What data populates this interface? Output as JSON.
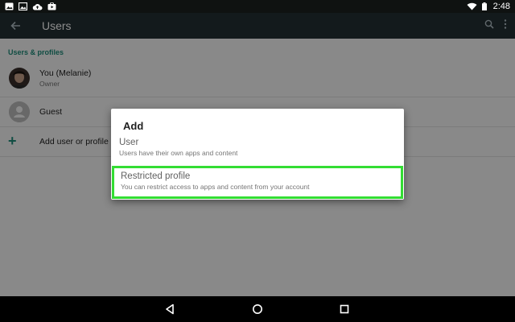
{
  "status_bar": {
    "time": "2:48",
    "left_icons": [
      "image-icon",
      "image-icon",
      "cloud-upload-icon",
      "play-store-icon"
    ],
    "right_icons": [
      "wifi-icon",
      "battery-icon"
    ]
  },
  "toolbar": {
    "title": "Users",
    "back_icon": "arrow-back-icon",
    "actions": [
      "search-icon",
      "more-vert-icon"
    ]
  },
  "section": {
    "header": "Users & profiles"
  },
  "users": [
    {
      "name": "You (Melanie)",
      "subtitle": "Owner",
      "avatar": "photo-avatar"
    },
    {
      "name": "Guest",
      "subtitle": "",
      "avatar": "person-icon"
    }
  ],
  "add_user": {
    "label": "Add user or profile",
    "icon": "plus-icon"
  },
  "dialog": {
    "title": "Add",
    "options": [
      {
        "title": "User",
        "subtitle": "Users have their own apps and content"
      },
      {
        "title": "Restricted profile",
        "subtitle": "You can restrict access to apps and content from your account"
      }
    ],
    "highlight_color": "#33dd33"
  },
  "nav_bar": {
    "buttons": [
      "back-triangle-icon",
      "home-circle-icon",
      "recents-square-icon"
    ]
  },
  "colors": {
    "accent": "#1e8c7a",
    "toolbar": "#243033",
    "status_bar": "#0f1211"
  }
}
